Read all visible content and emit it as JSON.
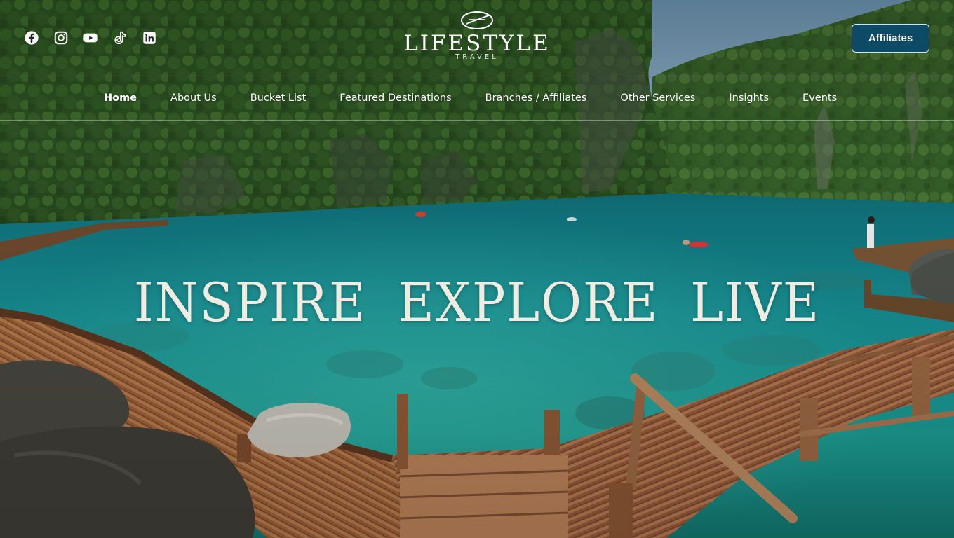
{
  "brand": {
    "name": "LIFESTYLE",
    "tagline": "TRAVEL",
    "emblem_icon": "globe-swoosh-icon"
  },
  "social": [
    {
      "name": "facebook",
      "icon": "facebook-icon"
    },
    {
      "name": "instagram",
      "icon": "instagram-icon"
    },
    {
      "name": "youtube",
      "icon": "youtube-icon"
    },
    {
      "name": "tiktok",
      "icon": "tiktok-icon"
    },
    {
      "name": "linkedin",
      "icon": "linkedin-icon"
    }
  ],
  "header": {
    "cta_label": "Affiliates"
  },
  "nav": {
    "items": [
      {
        "label": "Home",
        "active": true
      },
      {
        "label": "About Us",
        "active": false
      },
      {
        "label": "Bucket List",
        "active": false
      },
      {
        "label": "Featured Destinations",
        "active": false
      },
      {
        "label": "Branches / Affiliates",
        "active": false
      },
      {
        "label": "Other Services",
        "active": false
      },
      {
        "label": "Insights",
        "active": false
      },
      {
        "label": "Events",
        "active": false
      }
    ]
  },
  "hero": {
    "headline": "INSPIRE EXPLORE LIVE"
  },
  "colors": {
    "cta_background": "#0c4a66",
    "nav_text": "#ffffff",
    "hero_text": "#f1ece2",
    "lagoon": "#1a9a96",
    "foliage": "#2f5a26",
    "boardwalk": "#a7683f"
  }
}
